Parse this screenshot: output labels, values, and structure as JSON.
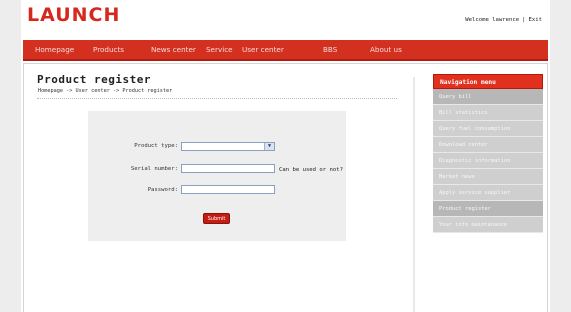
{
  "header": {
    "brand": "LAUNCH",
    "welcome": "Welcome lawrence",
    "separator": "|",
    "exit": "Exit"
  },
  "nav": {
    "items": [
      "Homepage",
      "Products",
      "News center",
      "Service",
      "User center",
      "BBS",
      "About us"
    ]
  },
  "main": {
    "title": "Product register",
    "breadcrumb": "Homepage -> User center -> Product register"
  },
  "form": {
    "product_type_label": "Product type:",
    "product_type_value": "",
    "serial_number_label": "Serial number:",
    "serial_number_value": "",
    "serial_hint": "Can be used or not?",
    "password_label": "Password:",
    "password_value": "",
    "submit_label": "Submit"
  },
  "sidebar": {
    "heading": "Navigation menu",
    "items": [
      "Query bill",
      "Bill statistics",
      "Query fuel consumption",
      "Download center",
      "Diagnostic information",
      "Market news",
      "Apply service supplier",
      "Product register",
      "Your info maintenance"
    ]
  },
  "colors": {
    "accent": "#d4301f",
    "brand": "#d6281c",
    "sidebar_item": "#cfcfcf",
    "sidebar_item_active": "#b7b7b7"
  }
}
